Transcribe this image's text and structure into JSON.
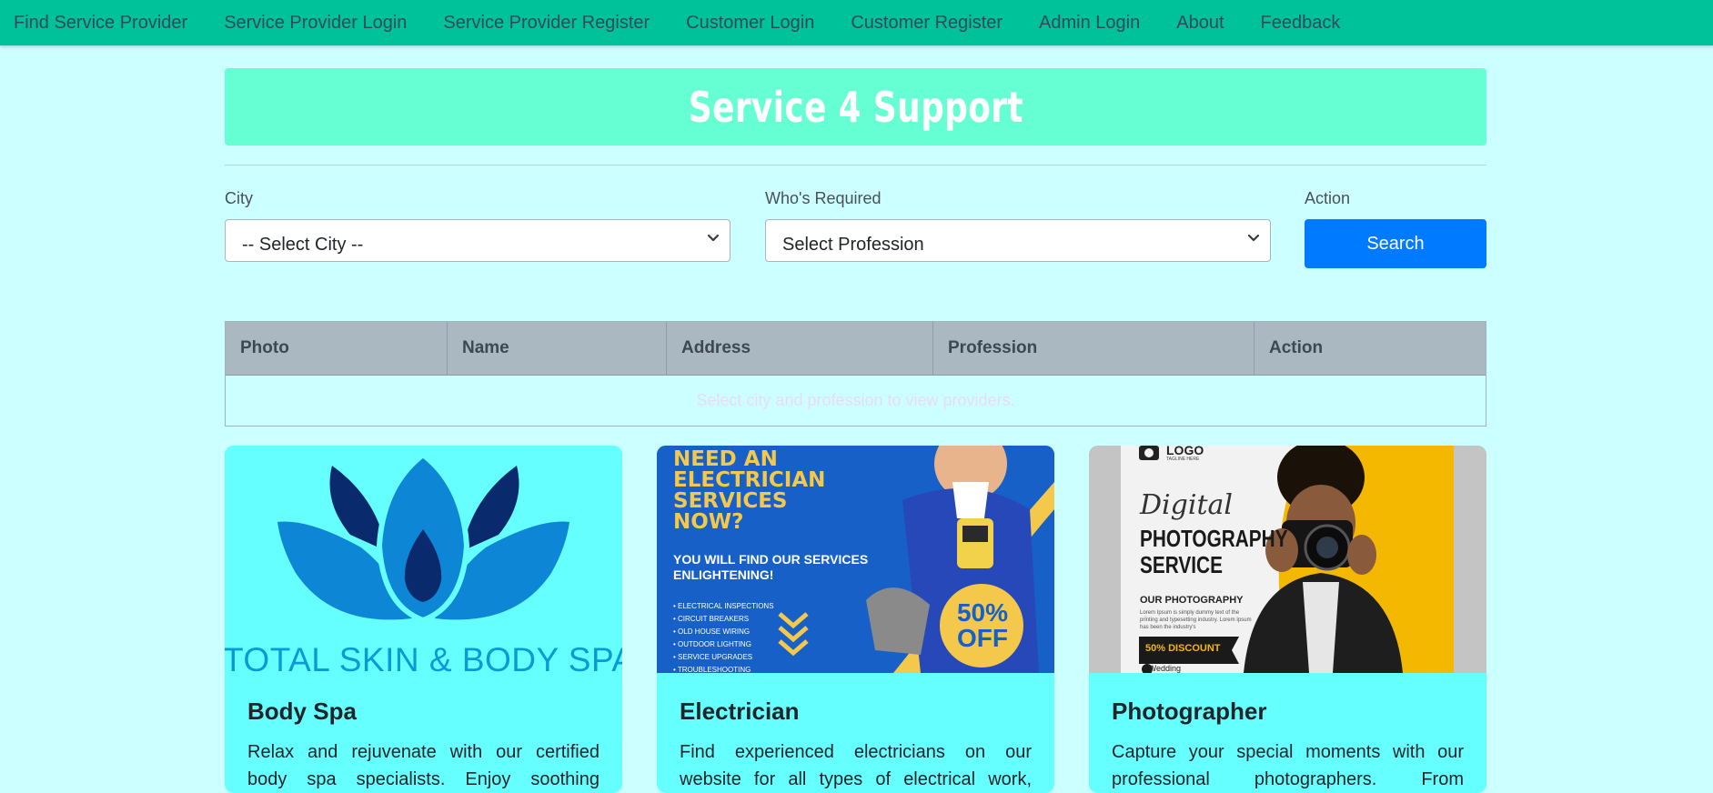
{
  "nav": {
    "items": [
      "Find Service Provider",
      "Service Provider Login",
      "Service Provider Register",
      "Customer Login",
      "Customer Register",
      "Admin Login",
      "About",
      "Feedback"
    ]
  },
  "banner": {
    "title": "Service 4 Support"
  },
  "form": {
    "city_label": "City",
    "city_value": "-- Select City --",
    "profession_label": "Who's Required",
    "profession_value": "Select Profession",
    "action_label": "Action",
    "search_label": "Search"
  },
  "table": {
    "headers": [
      "Photo",
      "Name",
      "Address",
      "Profession",
      "Action"
    ],
    "empty_message": "Select city and profession to view providers."
  },
  "cards": [
    {
      "title": "Body Spa",
      "text": "Relax and rejuvenate with our certified body spa specialists. Enjoy soothing",
      "image": {
        "logo_text": "TOTAL SKIN & BODY SPA",
        "icon": "lotus-icon"
      }
    },
    {
      "title": "Electrician",
      "text": "Find experienced electricians on our website for all types of electrical work,",
      "image": {
        "headline": [
          "NEED AN",
          "ELECTRICIAN",
          "SERVICES",
          "NOW?"
        ],
        "subline": [
          "YOU WILL FIND OUR SERVICES",
          "ENLIGHTENING!"
        ],
        "list": [
          "• ELECTRICAL INSPECTIONS",
          "• CIRCUIT BREAKERS",
          "• OLD HOUSE WIRING",
          "• OUTDOOR LIGHTING",
          "• SERVICE UPGRADES",
          "• TROUBLESHOOTING"
        ],
        "badge_top": "50%",
        "badge_bottom": "OFF"
      }
    },
    {
      "title": "Photographer",
      "text": "Capture your special moments with our professional photographers. From",
      "image": {
        "logo": "LOGO",
        "tagline": "TAGLINE HERE",
        "script": "Digital",
        "headline": [
          "PHOTOGRAPHY",
          "SERVICE"
        ],
        "sub": "OUR PHOTOGRAPHY",
        "body": "Lorem Ipsum is simply dummy text of the printing and typesetting industry. Lorem Ipsum has been the industry's",
        "discount": "50% DISCOUNT",
        "bullet": "• Wedding"
      }
    }
  ],
  "colors": {
    "page_bg": "#ccffff",
    "navbar": "#00c29a",
    "banner": "#66ffd4",
    "primary": "#007bff",
    "card_bg": "#66ffff"
  }
}
